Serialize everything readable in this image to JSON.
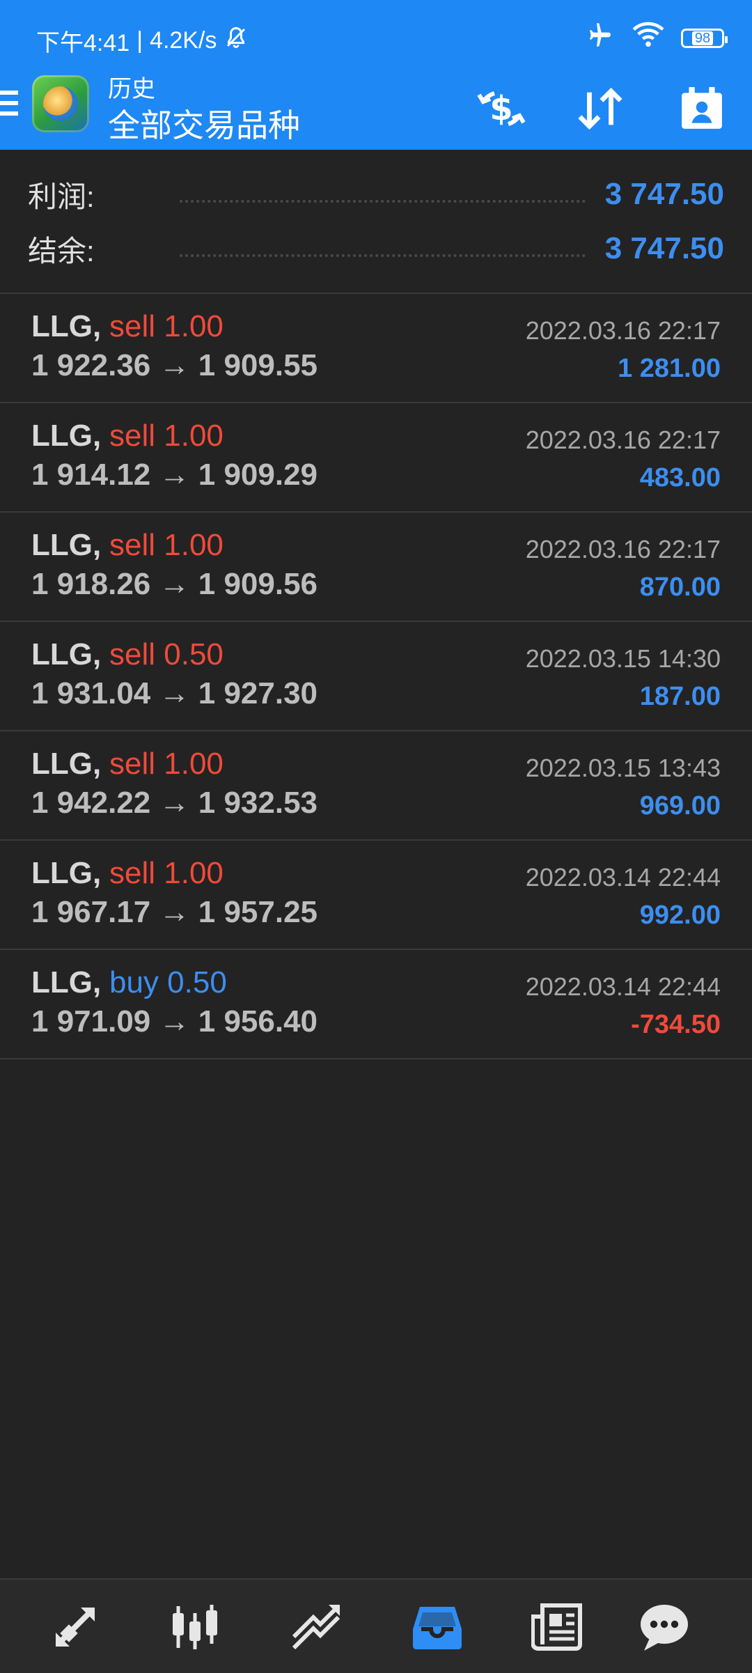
{
  "status_bar": {
    "time": "下午4:41",
    "separator": "|",
    "speed": "4.2K/s",
    "battery": "98"
  },
  "header": {
    "subtitle": "历史",
    "title": "全部交易品种"
  },
  "summary": {
    "profit_label": "利润:",
    "profit_value": "3 747.50",
    "balance_label": "结余:",
    "balance_value": "3 747.50"
  },
  "trades": [
    {
      "symbol": "LLG,",
      "side": "sell 1.00",
      "side_type": "sell",
      "open": "1 922.36",
      "close": "1 909.55",
      "time": "2022.03.16 22:17",
      "profit": "1 281.00",
      "profit_type": "pos"
    },
    {
      "symbol": "LLG,",
      "side": "sell 1.00",
      "side_type": "sell",
      "open": "1 914.12",
      "close": "1 909.29",
      "time": "2022.03.16 22:17",
      "profit": "483.00",
      "profit_type": "pos"
    },
    {
      "symbol": "LLG,",
      "side": "sell 1.00",
      "side_type": "sell",
      "open": "1 918.26",
      "close": "1 909.56",
      "time": "2022.03.16 22:17",
      "profit": "870.00",
      "profit_type": "pos"
    },
    {
      "symbol": "LLG,",
      "side": "sell 0.50",
      "side_type": "sell",
      "open": "1 931.04",
      "close": "1 927.30",
      "time": "2022.03.15 14:30",
      "profit": "187.00",
      "profit_type": "pos"
    },
    {
      "symbol": "LLG,",
      "side": "sell 1.00",
      "side_type": "sell",
      "open": "1 942.22",
      "close": "1 932.53",
      "time": "2022.03.15 13:43",
      "profit": "969.00",
      "profit_type": "pos"
    },
    {
      "symbol": "LLG,",
      "side": "sell 1.00",
      "side_type": "sell",
      "open": "1 967.17",
      "close": "1 957.25",
      "time": "2022.03.14 22:44",
      "profit": "992.00",
      "profit_type": "pos"
    },
    {
      "symbol": "LLG,",
      "side": "buy 0.50",
      "side_type": "buy",
      "open": "1 971.09",
      "close": "1 956.40",
      "time": "2022.03.14 22:44",
      "profit": "-734.50",
      "profit_type": "neg"
    }
  ],
  "arrow": "→",
  "colors": {
    "header_bg": "#1e88f5",
    "background": "#232323",
    "positive": "#3d8ef0",
    "negative": "#f04a3a",
    "active_tab": "#2f8ef5"
  },
  "icons": {
    "status": [
      "mute-bell-icon",
      "airplane-icon",
      "wifi-icon",
      "battery-icon"
    ],
    "toolbar": [
      "currency-exchange-icon",
      "sort-icon",
      "calendar-person-icon"
    ],
    "bottom_tabs": [
      "quotes-icon",
      "chart-candles-icon",
      "trade-icon",
      "history-icon",
      "news-icon",
      "chat-icon"
    ]
  }
}
